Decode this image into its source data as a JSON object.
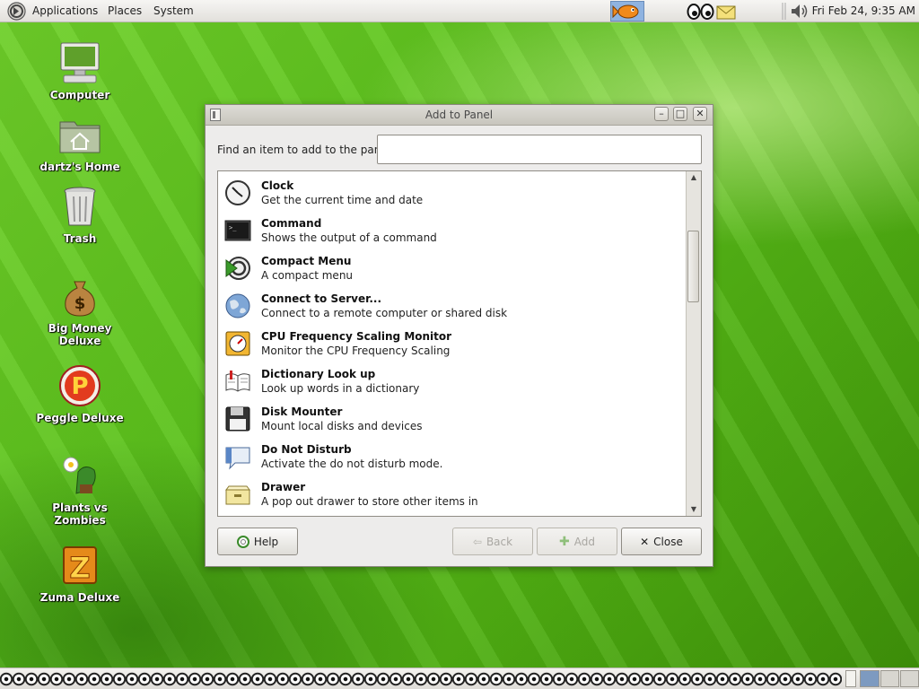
{
  "top_panel": {
    "menus": [
      "Applications",
      "Places",
      "System"
    ],
    "clock": "Fri Feb 24,  9:35 AM"
  },
  "desktop_icons": [
    {
      "label": "Computer",
      "icon": "computer-icon"
    },
    {
      "label": "dartz's Home",
      "icon": "home-folder-icon"
    },
    {
      "label": "Trash",
      "icon": "trash-icon"
    },
    {
      "label": "Big Money Deluxe",
      "icon": "money-bag-icon"
    },
    {
      "label": "Peggle Deluxe",
      "icon": "peggle-icon"
    },
    {
      "label": "Plants vs Zombies",
      "icon": "plants-zombies-icon"
    },
    {
      "label": "Zuma Deluxe",
      "icon": "zuma-icon"
    }
  ],
  "dialog": {
    "title": "Add to Panel",
    "find_label": "Find an item to add to the panel:",
    "find_value": "",
    "items": [
      {
        "title": "Clock",
        "desc": "Get the current time and date",
        "icon": "clock-icon"
      },
      {
        "title": "Command",
        "desc": "Shows the output of a command",
        "icon": "terminal-icon"
      },
      {
        "title": "Compact Menu",
        "desc": "A compact menu",
        "icon": "compact-menu-icon"
      },
      {
        "title": "Connect to Server...",
        "desc": "Connect to a remote computer or shared disk",
        "icon": "globe-icon"
      },
      {
        "title": "CPU Frequency Scaling Monitor",
        "desc": "Monitor the CPU Frequency Scaling",
        "icon": "cpu-gauge-icon"
      },
      {
        "title": "Dictionary Look up",
        "desc": "Look up words in a dictionary",
        "icon": "dictionary-icon"
      },
      {
        "title": "Disk Mounter",
        "desc": "Mount local disks and devices",
        "icon": "floppy-disk-icon"
      },
      {
        "title": "Do Not Disturb",
        "desc": "Activate the do not disturb mode.",
        "icon": "speech-bubble-icon"
      },
      {
        "title": "Drawer",
        "desc": "A pop out drawer to store other items in",
        "icon": "drawer-icon"
      }
    ],
    "buttons": {
      "help": "Help",
      "back": "Back",
      "add": "Add",
      "close": "Close"
    }
  }
}
